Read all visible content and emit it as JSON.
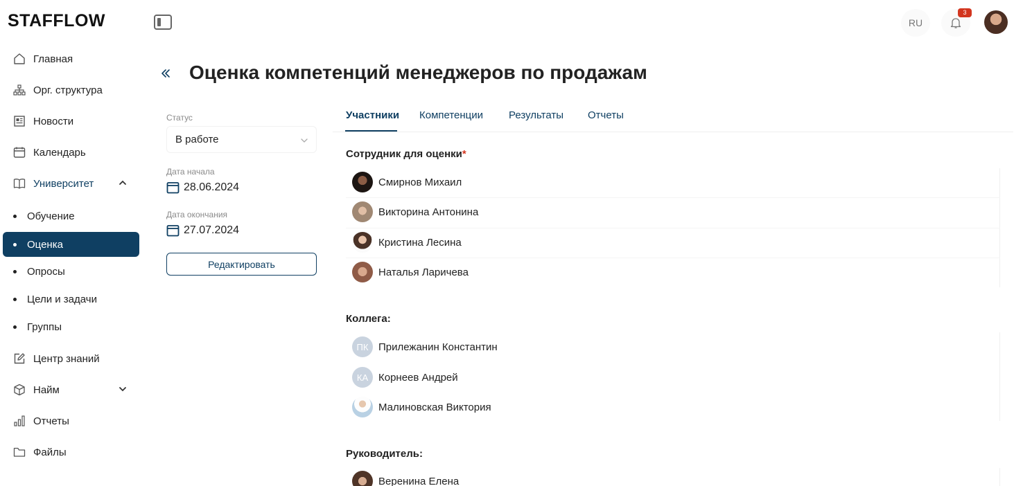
{
  "app": {
    "logo": "STAFFLOW"
  },
  "topbar": {
    "lang": "RU",
    "notifications_count": "3"
  },
  "sidebar": {
    "items": [
      {
        "label": "Главная",
        "icon": "home-icon"
      },
      {
        "label": "Орг. структура",
        "icon": "org-structure-icon"
      },
      {
        "label": "Новости",
        "icon": "newspaper-icon"
      },
      {
        "label": "Календарь",
        "icon": "calendar-icon"
      },
      {
        "label": "Университет",
        "icon": "book-icon",
        "expanded": true
      },
      {
        "label": "Центр знаний",
        "icon": "edit-icon"
      },
      {
        "label": "Найм",
        "icon": "box-icon",
        "expanded": false
      },
      {
        "label": "Отчеты",
        "icon": "bar-chart-icon"
      },
      {
        "label": "Файлы",
        "icon": "folder-icon"
      }
    ],
    "university_sub": [
      {
        "label": "Обучение"
      },
      {
        "label": "Оценка",
        "selected": true
      },
      {
        "label": "Опросы"
      },
      {
        "label": "Цели и задачи"
      },
      {
        "label": "Группы"
      }
    ]
  },
  "page": {
    "title": "Оценка компетенций менеджеров по продажам"
  },
  "info": {
    "status_label": "Статус",
    "status_value": "В работе",
    "start_label": "Дата начала",
    "start_value": "28.06.2024",
    "end_label": "Дата окончания",
    "end_value": "27.07.2024",
    "edit_button": "Редактировать"
  },
  "tabs": [
    {
      "label": "Участники",
      "active": true
    },
    {
      "label": "Компетенции"
    },
    {
      "label": "Результаты"
    },
    {
      "label": "Отчеты"
    }
  ],
  "sections": {
    "employee": {
      "title": "Сотрудник для оценки",
      "required_mark": "*",
      "people": [
        "Смирнов Михаил",
        "Викторина Антонина",
        "Кристина Лесина",
        "Наталья Ларичева"
      ]
    },
    "colleague": {
      "title": "Коллега:",
      "people": [
        {
          "name": "Прилежанин Константин",
          "initials": "ПК"
        },
        {
          "name": "Корнеев Андрей",
          "initials": "КА"
        },
        {
          "name": "Малиновская Виктория"
        }
      ]
    },
    "manager": {
      "title": "Руководитель:",
      "people": [
        "Веренина Елена"
      ]
    }
  },
  "colors": {
    "primary": "#0f3f62",
    "danger": "#d3361f",
    "muted": "#8a8a8a"
  }
}
